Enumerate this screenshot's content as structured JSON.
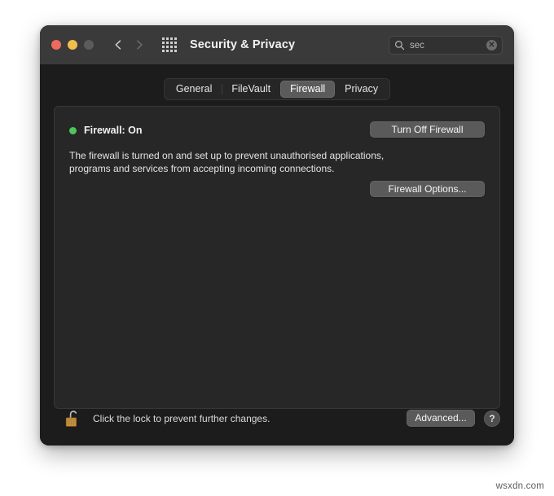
{
  "window": {
    "title": "Security & Privacy",
    "traffic_lights": [
      {
        "name": "close",
        "color": "#ef6a5e"
      },
      {
        "name": "minimize",
        "color": "#f2bd4d"
      },
      {
        "name": "zoom",
        "color": "#5b5b5b"
      }
    ],
    "nav": {
      "back_icon": "chevron-left-icon",
      "forward_icon": "chevron-right-icon",
      "grid_icon": "show-all-grid-icon"
    }
  },
  "search": {
    "icon": "search-icon",
    "value": "sec",
    "placeholder": "Search",
    "clear_icon": "clear-circle-icon",
    "clear_glyph": "✕"
  },
  "tabs": [
    {
      "label": "General",
      "selected": false
    },
    {
      "label": "FileVault",
      "selected": false
    },
    {
      "label": "Firewall",
      "selected": true
    },
    {
      "label": "Privacy",
      "selected": false
    }
  ],
  "firewall": {
    "status_dot_color": "#4fc65a",
    "status_label": "Firewall: On",
    "description": "The firewall is turned on and set up to prevent unauthorised applications, programs and services from accepting incoming connections.",
    "turn_off_button": "Turn Off Firewall",
    "options_button": "Firewall Options..."
  },
  "footer": {
    "lock_icon": "unlocked-padlock-icon",
    "lock_body_color": "#c8913f",
    "lock_message": "Click the lock to prevent further changes.",
    "advanced_button": "Advanced...",
    "help_button": "?"
  },
  "watermark": {
    "text": "wsxdn.com"
  }
}
